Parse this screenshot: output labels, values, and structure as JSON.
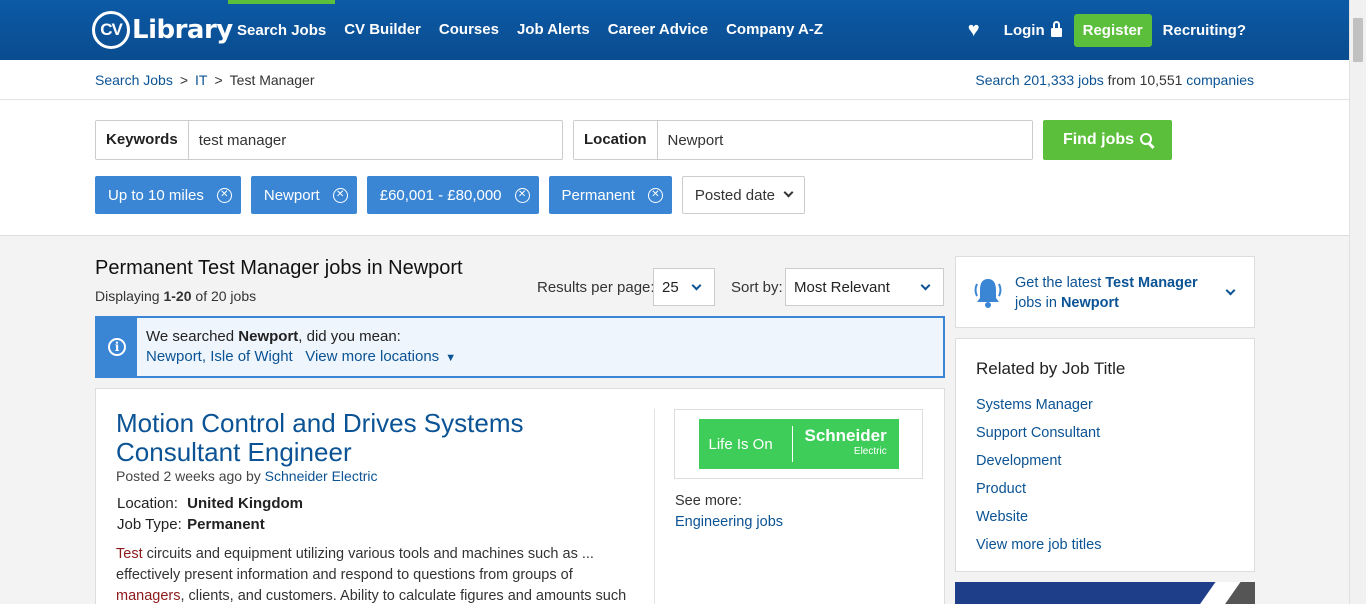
{
  "header": {
    "logo_cv": "CV",
    "logo_library": "Library",
    "nav": [
      "Search Jobs",
      "CV Builder",
      "Courses",
      "Job Alerts",
      "Career Advice",
      "Company A-Z"
    ],
    "login": "Login",
    "register": "Register",
    "recruiting": "Recruiting?"
  },
  "breadcrumb": {
    "items": [
      "Search Jobs",
      "IT",
      "Test Manager"
    ],
    "separator": ">"
  },
  "stats": {
    "prefix": "Search ",
    "jobs": "201,333 jobs",
    "middle": " from 10,551 ",
    "companies": "companies"
  },
  "search": {
    "keywords_label": "Keywords",
    "keywords_value": "test manager",
    "location_label": "Location",
    "location_value": "Newport",
    "find_label": "Find jobs"
  },
  "filters": {
    "chips": [
      "Up to 10 miles",
      "Newport",
      "£60,001 - £80,000",
      "Permanent"
    ],
    "posted_date": "Posted date"
  },
  "results": {
    "title": "Permanent Test Manager jobs in Newport",
    "displaying_prefix": "Displaying ",
    "displaying_range": "1-20",
    "displaying_suffix": " of 20 jobs",
    "per_page_label": "Results per page:",
    "per_page_value": "25",
    "sort_label": "Sort by:",
    "sort_value": "Most Relevant"
  },
  "notice": {
    "prefix": "We searched ",
    "term": "Newport",
    "suffix": ", did you mean:",
    "suggestion": "Newport, Isle of Wight",
    "more": "View more locations"
  },
  "job": {
    "title": "Motion Control and Drives Systems Consultant Engineer",
    "posted_prefix": "Posted 2 weeks ago by ",
    "company": "Schneider Electric",
    "location_label": "Location:",
    "location_value": "United Kingdom",
    "type_label": "Job Type:",
    "type_value": "Permanent",
    "desc_hl1": "Test",
    "desc_1": " circuits and equipment utilizing various tools and machines such as ... effectively present information and respond to questions from groups of ",
    "desc_hl2": "managers",
    "desc_2": ", clients, and customers. Ability to calculate figures and amounts such",
    "see_more": "See more:",
    "see_more_link": "Engineering jobs",
    "logo_life": "Life Is On",
    "logo_name": "Schneider",
    "logo_sub": "Electric"
  },
  "sidebar": {
    "alert_prefix": "Get the latest ",
    "alert_term": "Test Manager",
    "alert_mid": " jobs in ",
    "alert_location": "Newport",
    "related_title": "Related by Job Title",
    "related": [
      "Systems Manager",
      "Support Consultant",
      "Development",
      "Product",
      "Website",
      "View more job titles"
    ]
  },
  "colors": {
    "header_blue": "#0a4c8f",
    "accent_green": "#5cbf3c",
    "chip_blue": "#3a86d4",
    "link_blue": "#0b5394",
    "brand_green": "#3dcd58"
  }
}
